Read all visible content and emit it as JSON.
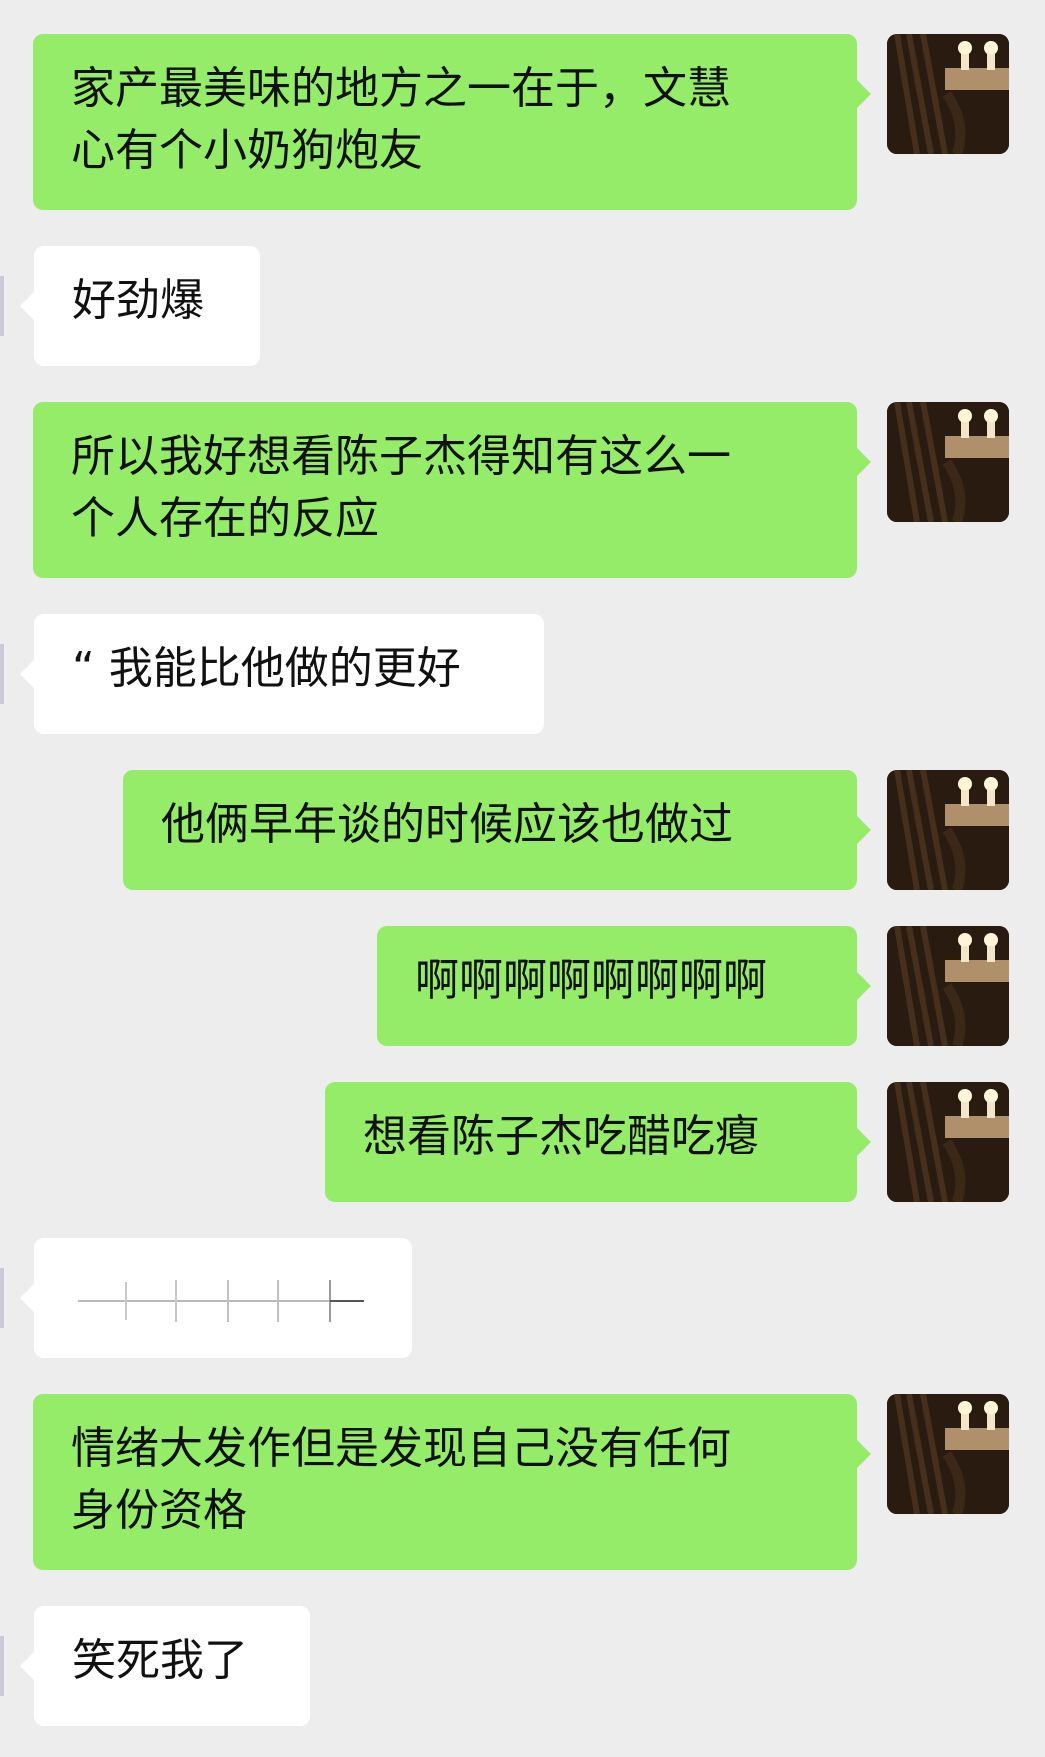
{
  "chat": {
    "messages": [
      {
        "side": "me",
        "lines": [
          "家产最美味的地方之一在于，文慧",
          "心有个小奶狗炮友"
        ]
      },
      {
        "side": "other",
        "lines": [
          "好劲爆"
        ]
      },
      {
        "side": "me",
        "lines": [
          "所以我好想看陈子杰得知有这么一",
          "个人存在的反应"
        ]
      },
      {
        "side": "other",
        "lines": [
          "“ 我能比他做的更好"
        ]
      },
      {
        "side": "me",
        "lines": [
          "他俩早年谈的时候应该也做过"
        ]
      },
      {
        "side": "me",
        "lines": [
          "啊啊啊啊啊啊啊啊"
        ]
      },
      {
        "side": "me",
        "lines": [
          "想看陈子杰吃醋吃瘪"
        ]
      },
      {
        "side": "other",
        "lines": []
      },
      {
        "side": "me",
        "lines": [
          "情绪大发作但是发现自己没有任何",
          "身份资格"
        ]
      },
      {
        "side": "other",
        "lines": [
          "笑死我了"
        ]
      }
    ]
  },
  "colors": {
    "background": "#ededed",
    "me_bubble": "#95ec69",
    "other_bubble": "#ffffff",
    "text": "#111111"
  },
  "icons": {
    "avatar": "candle-avatar-icon",
    "sticker": "scratch-marks-sticker-icon"
  }
}
